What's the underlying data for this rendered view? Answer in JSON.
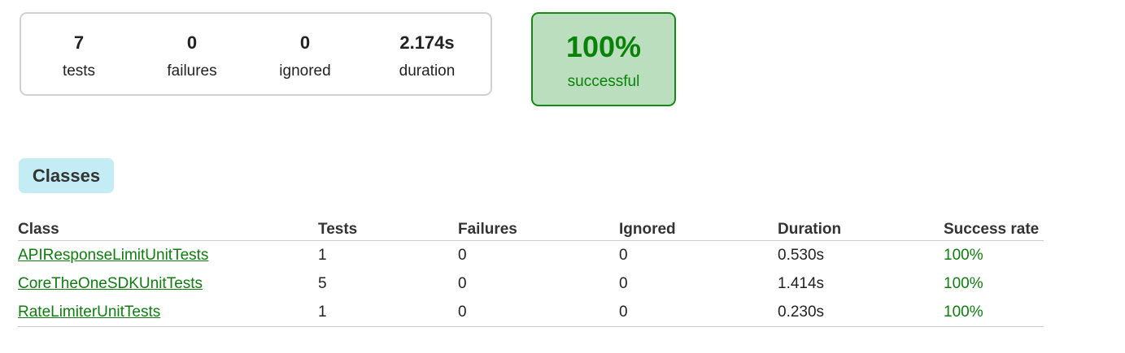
{
  "summary": {
    "counters": [
      {
        "value": "7",
        "label": "tests"
      },
      {
        "value": "0",
        "label": "failures"
      },
      {
        "value": "0",
        "label": "ignored"
      },
      {
        "value": "2.174s",
        "label": "duration"
      }
    ],
    "success": {
      "value": "100%",
      "label": "successful"
    }
  },
  "tabs": {
    "classes_label": "Classes"
  },
  "table": {
    "headers": [
      "Class",
      "Tests",
      "Failures",
      "Ignored",
      "Duration",
      "Success rate"
    ],
    "rows": [
      {
        "class": "APIResponseLimitUnitTests",
        "tests": "1",
        "failures": "0",
        "ignored": "0",
        "duration": "0.530s",
        "rate": "100%"
      },
      {
        "class": "CoreTheOneSDKUnitTests",
        "tests": "5",
        "failures": "0",
        "ignored": "0",
        "duration": "1.414s",
        "rate": "100%"
      },
      {
        "class": "RateLimiterUnitTests",
        "tests": "1",
        "failures": "0",
        "ignored": "0",
        "duration": "0.230s",
        "rate": "100%"
      }
    ]
  },
  "colors": {
    "success_green": "#088308",
    "success_bg": "#bbdebf",
    "tab_bg": "#c3ecf4"
  }
}
